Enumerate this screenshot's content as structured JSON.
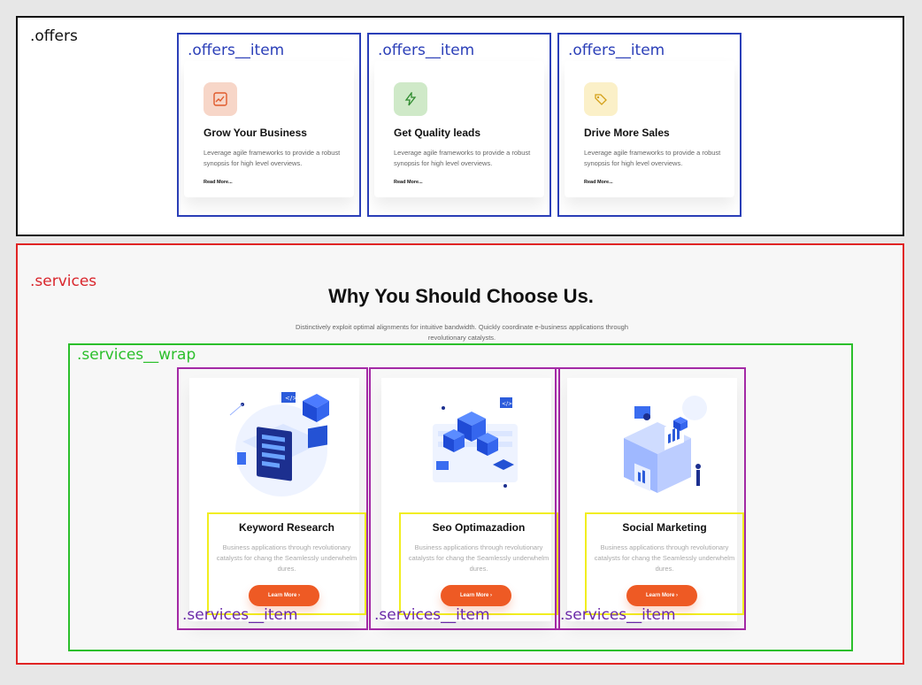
{
  "offers": {
    "annotation": ".offers",
    "item_annotation": ".offers__item",
    "items": [
      {
        "title": "Grow Your Business",
        "desc": "Leverage agile frameworks to provide a robust synopsis for high level overviews.",
        "more": "Read More...",
        "icon": "chart-icon",
        "icon_color": "#f7d6c8",
        "icon_glyph": "📈"
      },
      {
        "title": "Get Quality leads",
        "desc": "Leverage agile frameworks to provide a robust synopsis for high level overviews.",
        "more": "Read More...",
        "icon": "lightning-icon",
        "icon_color": "#cfe9c8",
        "icon_glyph": "⚡"
      },
      {
        "title": "Drive More Sales",
        "desc": "Leverage agile frameworks to provide a robust synopsis for high level overviews.",
        "more": "Read More...",
        "icon": "tag-icon",
        "icon_color": "#fbf0c8",
        "icon_glyph": "🏷"
      }
    ]
  },
  "services": {
    "annotation": ".services",
    "wrap_annotation": ".services__wrap",
    "item_annotation": ".services__item",
    "title": "Why You Should Choose Us.",
    "subtitle": "Distinctively exploit optimal alignments for intuitive bandwidth. Quickly coordinate e-business applications through revolutionary catalysts.",
    "items": [
      {
        "title": "Keyword Research",
        "desc": "Business applications through revolutionary catalysts for chang the Seamlessly underwhelm dures.",
        "button": "Learn More ›",
        "illustration": "keyword-research-illustration"
      },
      {
        "title": "Seo Optimazadion",
        "desc": "Business applications through revolutionary catalysts for chang the Seamlessly underwhelm dures.",
        "button": "Learn More ›",
        "illustration": "seo-illustration"
      },
      {
        "title": "Social Marketing",
        "desc": "Business applications through revolutionary catalysts for chang the Seamlessly underwhelm dures.",
        "button": "Learn More ›",
        "illustration": "social-marketing-illustration"
      }
    ]
  }
}
